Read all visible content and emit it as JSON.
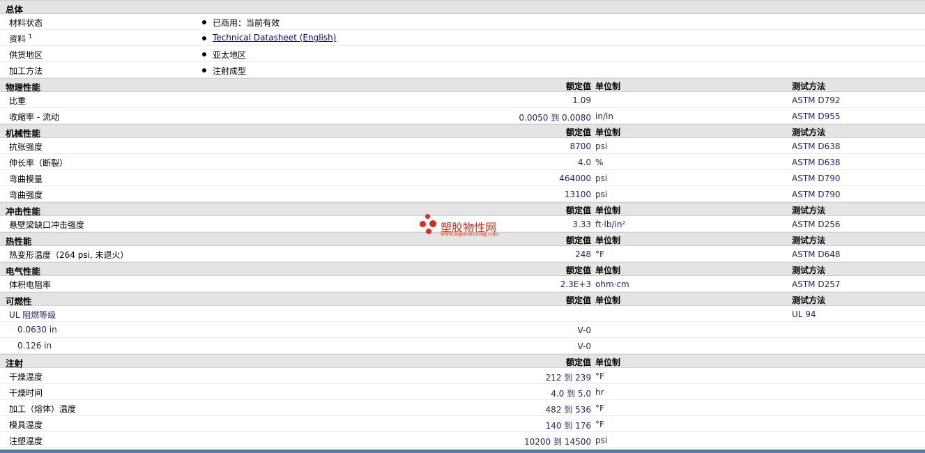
{
  "general": {
    "title": "总体",
    "rows": [
      {
        "label": "材料状态",
        "value": "已商用：当前有效"
      },
      {
        "label": "资料",
        "sup": "1",
        "value": "Technical Datasheet (English)"
      },
      {
        "label": "供货地区",
        "value": "亚太地区"
      },
      {
        "label": "加工方法",
        "value": "注射成型"
      }
    ]
  },
  "col_headers": {
    "rated": "额定值",
    "unit": "单位制",
    "method": "测试方法"
  },
  "sections": [
    {
      "title": "物理性能",
      "rows": [
        {
          "label": "比重",
          "value": "1.09",
          "unit": "",
          "method": "ASTM D792"
        },
        {
          "label": "收缩率 - 流动",
          "value": "0.0050 到 0.0080",
          "unit": "in/in",
          "method": "ASTM D955"
        }
      ]
    },
    {
      "title": "机械性能",
      "rows": [
        {
          "label": "抗张强度",
          "value": "8700",
          "unit": "psi",
          "method": "ASTM D638"
        },
        {
          "label": "伸长率（断裂）",
          "value": "4.0",
          "unit": "%",
          "method": "ASTM D638"
        },
        {
          "label": "弯曲模量",
          "value": "464000",
          "unit": "psi",
          "method": "ASTM D790"
        },
        {
          "label": "弯曲强度",
          "value": "13100",
          "unit": "psi",
          "method": "ASTM D790"
        }
      ]
    },
    {
      "title": "冲击性能",
      "rows": [
        {
          "label": "悬壁梁缺口冲击强度",
          "value": "3.33",
          "unit": "ft·lb/in²",
          "method": "ASTM D256"
        }
      ]
    },
    {
      "title": "热性能",
      "rows": [
        {
          "label": "热变形温度（264 psi, 未退火）",
          "value": "248",
          "unit": "°F",
          "method": "ASTM D648"
        }
      ]
    },
    {
      "title": "电气性能",
      "rows": [
        {
          "label": "体积电阻率",
          "value": "2.3E+3",
          "unit": "ohm·cm",
          "method": "ASTM D257"
        }
      ]
    },
    {
      "title": "可燃性",
      "rows": [
        {
          "label": "UL 阻燃等级",
          "value": "",
          "unit": "",
          "method": "UL 94",
          "blue": true
        },
        {
          "label": "0.0630 in",
          "value": "V-0",
          "unit": "",
          "method": "",
          "sub": true
        },
        {
          "label": "0.126 in",
          "value": "V-0",
          "unit": "",
          "method": "",
          "sub": true
        }
      ]
    },
    {
      "title": "注射",
      "noMethod": true,
      "rows": [
        {
          "label": "干燥温度",
          "value": "212 到 239",
          "unit": "°F",
          "method": ""
        },
        {
          "label": "干燥时间",
          "value": "4.0 到 5.0",
          "unit": "hr",
          "method": ""
        },
        {
          "label": "加工（熔体）温度",
          "value": "482 到 536",
          "unit": "°F",
          "method": ""
        },
        {
          "label": "模具温度",
          "value": "140 到 176",
          "unit": "°F",
          "method": ""
        },
        {
          "label": "注塑温度",
          "value": "10200 到 14500",
          "unit": "psi",
          "method": ""
        }
      ]
    }
  ],
  "watermark": {
    "name": "塑胶物性网",
    "url": "www.sujiaowuxing.com"
  }
}
